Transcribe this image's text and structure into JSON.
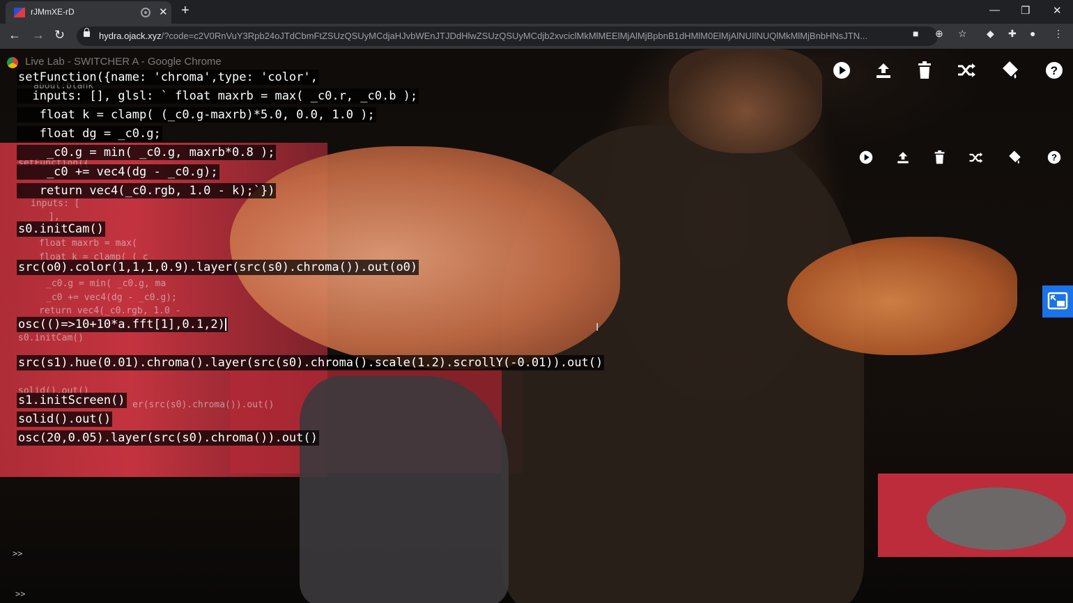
{
  "browser": {
    "tab_title": "rJMmXE-rD",
    "tab_close": "✕",
    "new_tab": "+",
    "host": "hydra.ojack.xyz",
    "url_path": "/?code=c2V0RnVuY3Rpb24oJTdCbmFtZSUzQSUyMCdjaHJvbWEnJTJDdHlwZSUzQSUyMCdjb2xvciclMkMlMEElMjAlMjBpbnB1dHMlM0ElMjAlNUIlNUQlMkMlMjBnbHNsJTN...",
    "back": "←",
    "forward": "→",
    "reload": "↻",
    "min": "—",
    "max": "❐",
    "close": "✕"
  },
  "overlap_window_title": "Live Lab - SWITCHER A - Google Chrome",
  "code_lines": {
    "l1": "setFunction({name: 'chroma',type: 'color',",
    "l2": "  inputs: [], glsl: ` float maxrb = max( _c0.r, _c0.b );",
    "l3": "   float k = clamp( (_c0.g-maxrb)*5.0, 0.0, 1.0 );",
    "l4": "   float dg = _c0.g;",
    "l5": "    _c0.g = min( _c0.g, maxrb*0.8 );",
    "l6": "    _c0 += vec4(dg - _c0.g);",
    "l7": "   return vec4(_c0.rgb, 1.0 - k);`})",
    "l8": "s0.initCam()",
    "l9": "src(o0).color(1,1,1,0.9).layer(src(s0).chroma()).out(o0)",
    "l10": "osc(()=>10+10*a.fft[1],0.1,2)",
    "l11": "src(s1).hue(0.01).chroma().layer(src(s0).chroma().scale(1.2).scrollY(-0.01)).out()",
    "l12": "s1.initScreen()",
    "l13": "solid().out()",
    "l14": "osc(20,0.05).layer(src(s0).chroma()).out()"
  },
  "ghost_lines": {
    "g1": "about:blank",
    "g2": "setFunction({",
    "g3": "inputs: [",
    "g4": "],",
    "g5": "float maxrb = max(",
    "g6": "float k = clamp( ( c",
    "g7": "_c0.g = min( _c0.g, ma",
    "g8": "_c0 += vec4(dg - _c0.g);",
    "g9": "return vec4(_c0.rgb, 1.0 -",
    "g10": "s0.initCam()",
    "g11": "solid().out()",
    "g12": "er(src(s0).chroma()).out()"
  },
  "prompts": {
    "p1": ">>",
    "p2": ">>"
  },
  "toolbar_icons": [
    "play-icon",
    "upload-icon",
    "trash-icon",
    "shuffle-icon",
    "paint-bucket-icon",
    "help-icon"
  ]
}
